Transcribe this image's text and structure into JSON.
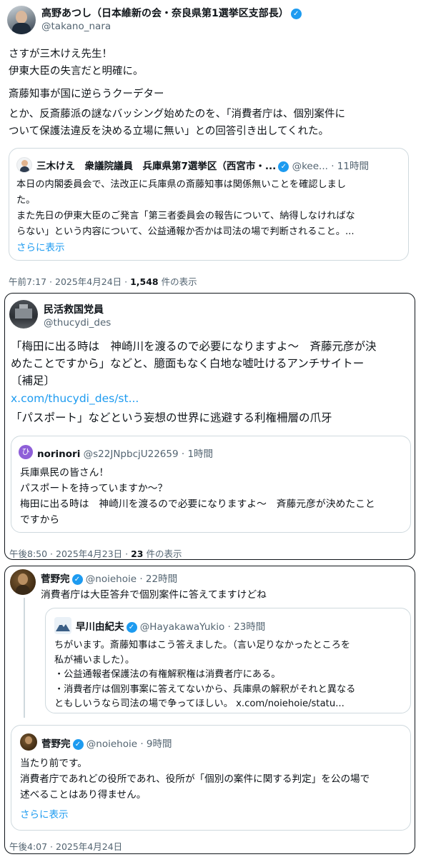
{
  "colors": {
    "link": "#1d9bf0",
    "muted": "#536471",
    "text": "#0f1419",
    "border": "#cfd9de"
  },
  "tweet1": {
    "author_name": "高野あつし（日本維新の会・奈良県第1選挙区支部長）",
    "handle": "@takano_nara",
    "body_p1": "さすが三木けえ先生！\n伊東大臣の失言だと明確に。",
    "body_p2": "斎藤知事が国に逆らうクーデター",
    "body_p3": "とか、反斎藤派の謎なバッシング始めたのを、「消費者庁は、個別案件に\nついて保護法違反を決める立場に無い」との回答引き出してくれた。",
    "quote": {
      "author_name": "三木けえ　衆議院議員　兵庫県第7選挙区（西宮市・...",
      "handle": "@kee...",
      "time": "· 11時間",
      "body": "本日の内閣委員会で、法改正に兵庫県の斎藤知事は関係無いことを確認しまし\nた。\nまた先日の伊東大臣のご発言「第三者委員会の報告について、納得しなければな\nらない」という内容について、公益通報か否かは司法の場で判断されること。...",
      "show_more": "さらに表示"
    },
    "time_text": "午前7:17 · 2025年4月24日 · ",
    "views_count": "1,548",
    "views_label": " 件の表示"
  },
  "tweet2": {
    "author_name": "民活救国党員",
    "handle": "@thucydi_des",
    "body": "「梅田に出る時は　神崎川を渡るので必要になりますよ～　斉藤元彦が決\nめたことですから」などと、臆面もなく白地な嘘吐けるアンチサイトー\n〔補足〕",
    "link_text": "x.com/thucydi_des/st...",
    "body2": "「パスポート」などという妄想の世界に逃避する利権柵層の爪牙",
    "quote": {
      "avatar_char": "ひ",
      "author_name": "norinori",
      "handle": "@s22JNpbcjU22659",
      "time": "· 1時間",
      "body": "兵庫県民の皆さん！\nパスポートを持っていますか～？\n梅田に出る時は　神崎川を渡るので必要になりますよ～　斉藤元彦が決めたこと\nですから"
    },
    "time_text": "午後8:50 · 2025年4月23日 · ",
    "views_count": "23",
    "views_label": " 件の表示"
  },
  "tweet3": {
    "author_name": "菅野完",
    "handle": "@noiehoie",
    "time": "· 22時間",
    "body": "消費者庁は大臣答弁で個別案件に答えてますけどね",
    "nested": {
      "author_name": "早川由紀夫",
      "handle": "@HayakawaYukio",
      "time": "· 23時間",
      "body": "ちがいます。斎藤知事はこう答えました。（言い足りなかったところを\n私が補いました）。\n・公益通報者保護法の有権解釈権は消費者庁にある。\n・消費者庁は個別事案に答えてないから、兵庫県の解釈がそれと異なる\nともしいうなら司法の場で争ってほしい。 x.com/noiehoie/statu..."
    },
    "quote": {
      "author_name": "菅野完",
      "handle": "@noiehoie",
      "time": "· 9時間",
      "body": "当たり前です。\n消費者庁であれどの役所であれ、役所が「個別の案件に関する判定」を公の場で\n述べることはあり得ません。",
      "show_more": "さらに表示"
    },
    "time_text": "午後4:07 · 2025年4月24日"
  }
}
